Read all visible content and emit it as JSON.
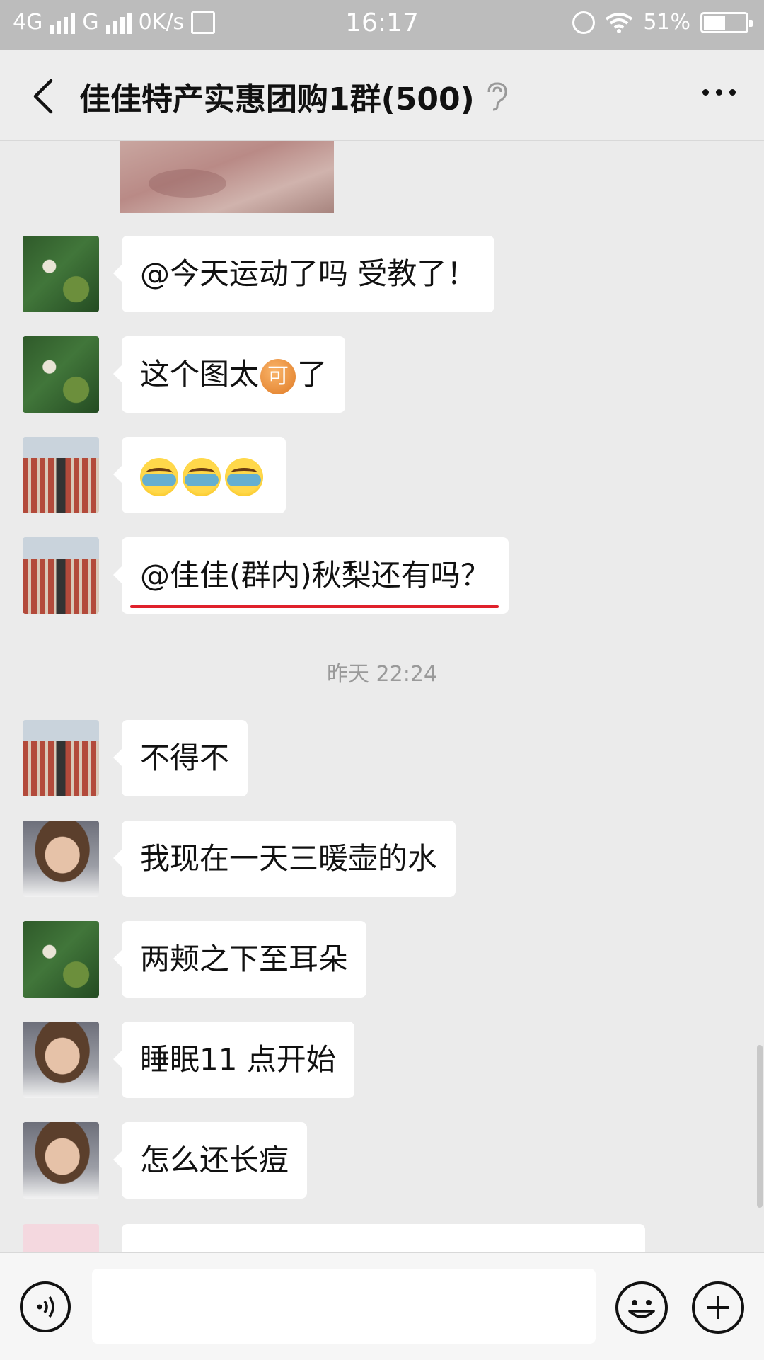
{
  "status_bar": {
    "network1": "4G",
    "network2": "G",
    "speed": "0K/s",
    "time": "16:17",
    "battery_percent": "51%",
    "battery_level": 0.51
  },
  "header": {
    "title": "佳佳特产实惠团购1群(500)"
  },
  "messages": [
    {
      "sender_avatar": "green-garden",
      "text": "@今天运动了吗  受教了！"
    },
    {
      "sender_avatar": "green-garden",
      "text_before": "这个图太",
      "badge": "可",
      "text_after": "了"
    },
    {
      "sender_avatar": "bridge-photo",
      "emojis": [
        "crying-laughing",
        "crying-laughing",
        "crying-laughing"
      ]
    },
    {
      "sender_avatar": "bridge-photo",
      "text": "@佳佳(群内)秋梨还有吗？",
      "underlined": true
    },
    {
      "sender_avatar": "bridge-photo",
      "text": "不得不"
    },
    {
      "sender_avatar": "girl-portrait",
      "text": "我现在一天三暖壶的水"
    },
    {
      "sender_avatar": "green-garden",
      "text": "两颊之下至耳朵"
    },
    {
      "sender_avatar": "girl-portrait",
      "text": "睡眠11 点开始"
    },
    {
      "sender_avatar": "girl-portrait",
      "text": "怎么还长痘"
    }
  ],
  "timestamp": "昨天 22:24",
  "input": {
    "placeholder": ""
  },
  "colors": {
    "accent_underline": "#e0212b",
    "background": "#ebebeb",
    "bubble": "#ffffff"
  }
}
